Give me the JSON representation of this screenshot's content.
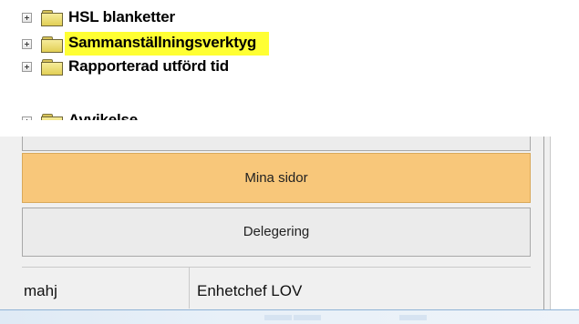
{
  "tree": {
    "items": [
      {
        "label": "HSL blanketter",
        "icon": "folder-icon",
        "highlighted": false
      },
      {
        "label": "Sammanställningsverktyg",
        "icon": "folder-icon",
        "highlighted": true
      },
      {
        "label": "Rapporterad utförd tid",
        "icon": "folder-icon",
        "highlighted": false
      },
      {
        "label": "Avvikelse",
        "icon": "folder-icon",
        "highlighted": false,
        "partially_visible": true
      }
    ],
    "highlight_color": "#ffff33"
  },
  "panel": {
    "buttons": {
      "mina_sidor": "Mina sidor",
      "delegering": "Delegering"
    },
    "accent_color": "#f8c77a"
  },
  "status_bar": {
    "user": "mahj",
    "role": "Enhetchef LOV"
  }
}
